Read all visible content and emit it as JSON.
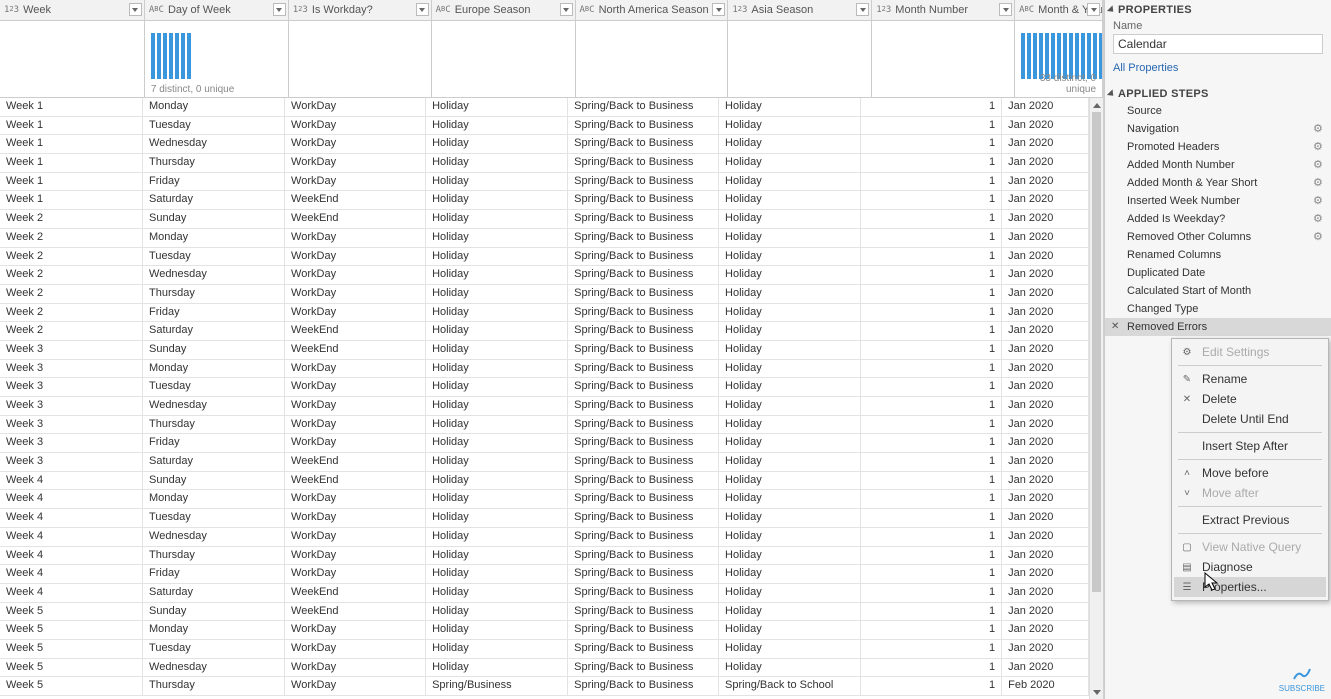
{
  "columns": [
    {
      "name": "Week",
      "type": "123",
      "width": "w0"
    },
    {
      "name": "Day of Week",
      "type": "ABC",
      "width": "w1"
    },
    {
      "name": "Is Workday?",
      "type": "123",
      "width": "w2"
    },
    {
      "name": "Europe Season",
      "type": "ABC",
      "width": "w3"
    },
    {
      "name": "North America Season",
      "type": "ABC",
      "width": "w4"
    },
    {
      "name": "Asia Season",
      "type": "123",
      "width": "w5"
    },
    {
      "name": "Month Number",
      "type": "123",
      "width": "w6"
    },
    {
      "name": "Month & Year",
      "type": "ABC",
      "width": "w7"
    }
  ],
  "spark": {
    "week_meta": "7 distinct, 0 unique",
    "month_meta": "33 distinct, 0 unique"
  },
  "rows": [
    [
      "Week 1",
      "Monday",
      "WorkDay",
      "Holiday",
      "Spring/Back to Business",
      "Holiday",
      "1",
      "Jan 2020"
    ],
    [
      "Week 1",
      "Tuesday",
      "WorkDay",
      "Holiday",
      "Spring/Back to Business",
      "Holiday",
      "1",
      "Jan 2020"
    ],
    [
      "Week 1",
      "Wednesday",
      "WorkDay",
      "Holiday",
      "Spring/Back to Business",
      "Holiday",
      "1",
      "Jan 2020"
    ],
    [
      "Week 1",
      "Thursday",
      "WorkDay",
      "Holiday",
      "Spring/Back to Business",
      "Holiday",
      "1",
      "Jan 2020"
    ],
    [
      "Week 1",
      "Friday",
      "WorkDay",
      "Holiday",
      "Spring/Back to Business",
      "Holiday",
      "1",
      "Jan 2020"
    ],
    [
      "Week 1",
      "Saturday",
      "WeekEnd",
      "Holiday",
      "Spring/Back to Business",
      "Holiday",
      "1",
      "Jan 2020"
    ],
    [
      "Week 2",
      "Sunday",
      "WeekEnd",
      "Holiday",
      "Spring/Back to Business",
      "Holiday",
      "1",
      "Jan 2020"
    ],
    [
      "Week 2",
      "Monday",
      "WorkDay",
      "Holiday",
      "Spring/Back to Business",
      "Holiday",
      "1",
      "Jan 2020"
    ],
    [
      "Week 2",
      "Tuesday",
      "WorkDay",
      "Holiday",
      "Spring/Back to Business",
      "Holiday",
      "1",
      "Jan 2020"
    ],
    [
      "Week 2",
      "Wednesday",
      "WorkDay",
      "Holiday",
      "Spring/Back to Business",
      "Holiday",
      "1",
      "Jan 2020"
    ],
    [
      "Week 2",
      "Thursday",
      "WorkDay",
      "Holiday",
      "Spring/Back to Business",
      "Holiday",
      "1",
      "Jan 2020"
    ],
    [
      "Week 2",
      "Friday",
      "WorkDay",
      "Holiday",
      "Spring/Back to Business",
      "Holiday",
      "1",
      "Jan 2020"
    ],
    [
      "Week 2",
      "Saturday",
      "WeekEnd",
      "Holiday",
      "Spring/Back to Business",
      "Holiday",
      "1",
      "Jan 2020"
    ],
    [
      "Week 3",
      "Sunday",
      "WeekEnd",
      "Holiday",
      "Spring/Back to Business",
      "Holiday",
      "1",
      "Jan 2020"
    ],
    [
      "Week 3",
      "Monday",
      "WorkDay",
      "Holiday",
      "Spring/Back to Business",
      "Holiday",
      "1",
      "Jan 2020"
    ],
    [
      "Week 3",
      "Tuesday",
      "WorkDay",
      "Holiday",
      "Spring/Back to Business",
      "Holiday",
      "1",
      "Jan 2020"
    ],
    [
      "Week 3",
      "Wednesday",
      "WorkDay",
      "Holiday",
      "Spring/Back to Business",
      "Holiday",
      "1",
      "Jan 2020"
    ],
    [
      "Week 3",
      "Thursday",
      "WorkDay",
      "Holiday",
      "Spring/Back to Business",
      "Holiday",
      "1",
      "Jan 2020"
    ],
    [
      "Week 3",
      "Friday",
      "WorkDay",
      "Holiday",
      "Spring/Back to Business",
      "Holiday",
      "1",
      "Jan 2020"
    ],
    [
      "Week 3",
      "Saturday",
      "WeekEnd",
      "Holiday",
      "Spring/Back to Business",
      "Holiday",
      "1",
      "Jan 2020"
    ],
    [
      "Week 4",
      "Sunday",
      "WeekEnd",
      "Holiday",
      "Spring/Back to Business",
      "Holiday",
      "1",
      "Jan 2020"
    ],
    [
      "Week 4",
      "Monday",
      "WorkDay",
      "Holiday",
      "Spring/Back to Business",
      "Holiday",
      "1",
      "Jan 2020"
    ],
    [
      "Week 4",
      "Tuesday",
      "WorkDay",
      "Holiday",
      "Spring/Back to Business",
      "Holiday",
      "1",
      "Jan 2020"
    ],
    [
      "Week 4",
      "Wednesday",
      "WorkDay",
      "Holiday",
      "Spring/Back to Business",
      "Holiday",
      "1",
      "Jan 2020"
    ],
    [
      "Week 4",
      "Thursday",
      "WorkDay",
      "Holiday",
      "Spring/Back to Business",
      "Holiday",
      "1",
      "Jan 2020"
    ],
    [
      "Week 4",
      "Friday",
      "WorkDay",
      "Holiday",
      "Spring/Back to Business",
      "Holiday",
      "1",
      "Jan 2020"
    ],
    [
      "Week 4",
      "Saturday",
      "WeekEnd",
      "Holiday",
      "Spring/Back to Business",
      "Holiday",
      "1",
      "Jan 2020"
    ],
    [
      "Week 5",
      "Sunday",
      "WeekEnd",
      "Holiday",
      "Spring/Back to Business",
      "Holiday",
      "1",
      "Jan 2020"
    ],
    [
      "Week 5",
      "Monday",
      "WorkDay",
      "Holiday",
      "Spring/Back to Business",
      "Holiday",
      "1",
      "Jan 2020"
    ],
    [
      "Week 5",
      "Tuesday",
      "WorkDay",
      "Holiday",
      "Spring/Back to Business",
      "Holiday",
      "1",
      "Jan 2020"
    ],
    [
      "Week 5",
      "Wednesday",
      "WorkDay",
      "Holiday",
      "Spring/Back to Business",
      "Holiday",
      "1",
      "Jan 2020"
    ],
    [
      "Week 5",
      "Thursday",
      "WorkDay",
      "Spring/Business",
      "Spring/Back to Business",
      "Spring/Back to School",
      "1",
      "Feb 2020"
    ]
  ],
  "properties": {
    "header": "PROPERTIES",
    "name_label": "Name",
    "name_value": "Calendar",
    "all_props": "All Properties"
  },
  "applied_steps": {
    "header": "APPLIED STEPS",
    "items": [
      {
        "label": "Source",
        "gear": false
      },
      {
        "label": "Navigation",
        "gear": true
      },
      {
        "label": "Promoted Headers",
        "gear": true
      },
      {
        "label": "Added Month Number",
        "gear": true
      },
      {
        "label": "Added Month & Year Short",
        "gear": true
      },
      {
        "label": "Inserted Week Number",
        "gear": true
      },
      {
        "label": "Added Is Weekday?",
        "gear": true
      },
      {
        "label": "Removed Other Columns",
        "gear": true
      },
      {
        "label": "Renamed Columns",
        "gear": false
      },
      {
        "label": "Duplicated Date",
        "gear": false
      },
      {
        "label": "Calculated Start of Month",
        "gear": false
      },
      {
        "label": "Changed Type",
        "gear": false
      },
      {
        "label": "Removed Errors",
        "gear": false,
        "selected": true
      }
    ]
  },
  "context_menu": [
    {
      "label": "Edit Settings",
      "disabled": true,
      "icon": "gear"
    },
    {
      "sep": true
    },
    {
      "label": "Rename",
      "icon": "rename"
    },
    {
      "label": "Delete",
      "icon": "x"
    },
    {
      "label": "Delete Until End"
    },
    {
      "sep": true
    },
    {
      "label": "Insert Step After"
    },
    {
      "sep": true
    },
    {
      "label": "Move before",
      "icon": "up"
    },
    {
      "label": "Move after",
      "disabled": true,
      "icon": "down"
    },
    {
      "sep": true
    },
    {
      "label": "Extract Previous"
    },
    {
      "sep": true
    },
    {
      "label": "View Native Query",
      "disabled": true,
      "icon": "doc"
    },
    {
      "label": "Diagnose",
      "icon": "diag"
    },
    {
      "label": "Properties...",
      "hover": true,
      "icon": "props"
    }
  ],
  "subscribe": "SUBSCRIBE"
}
